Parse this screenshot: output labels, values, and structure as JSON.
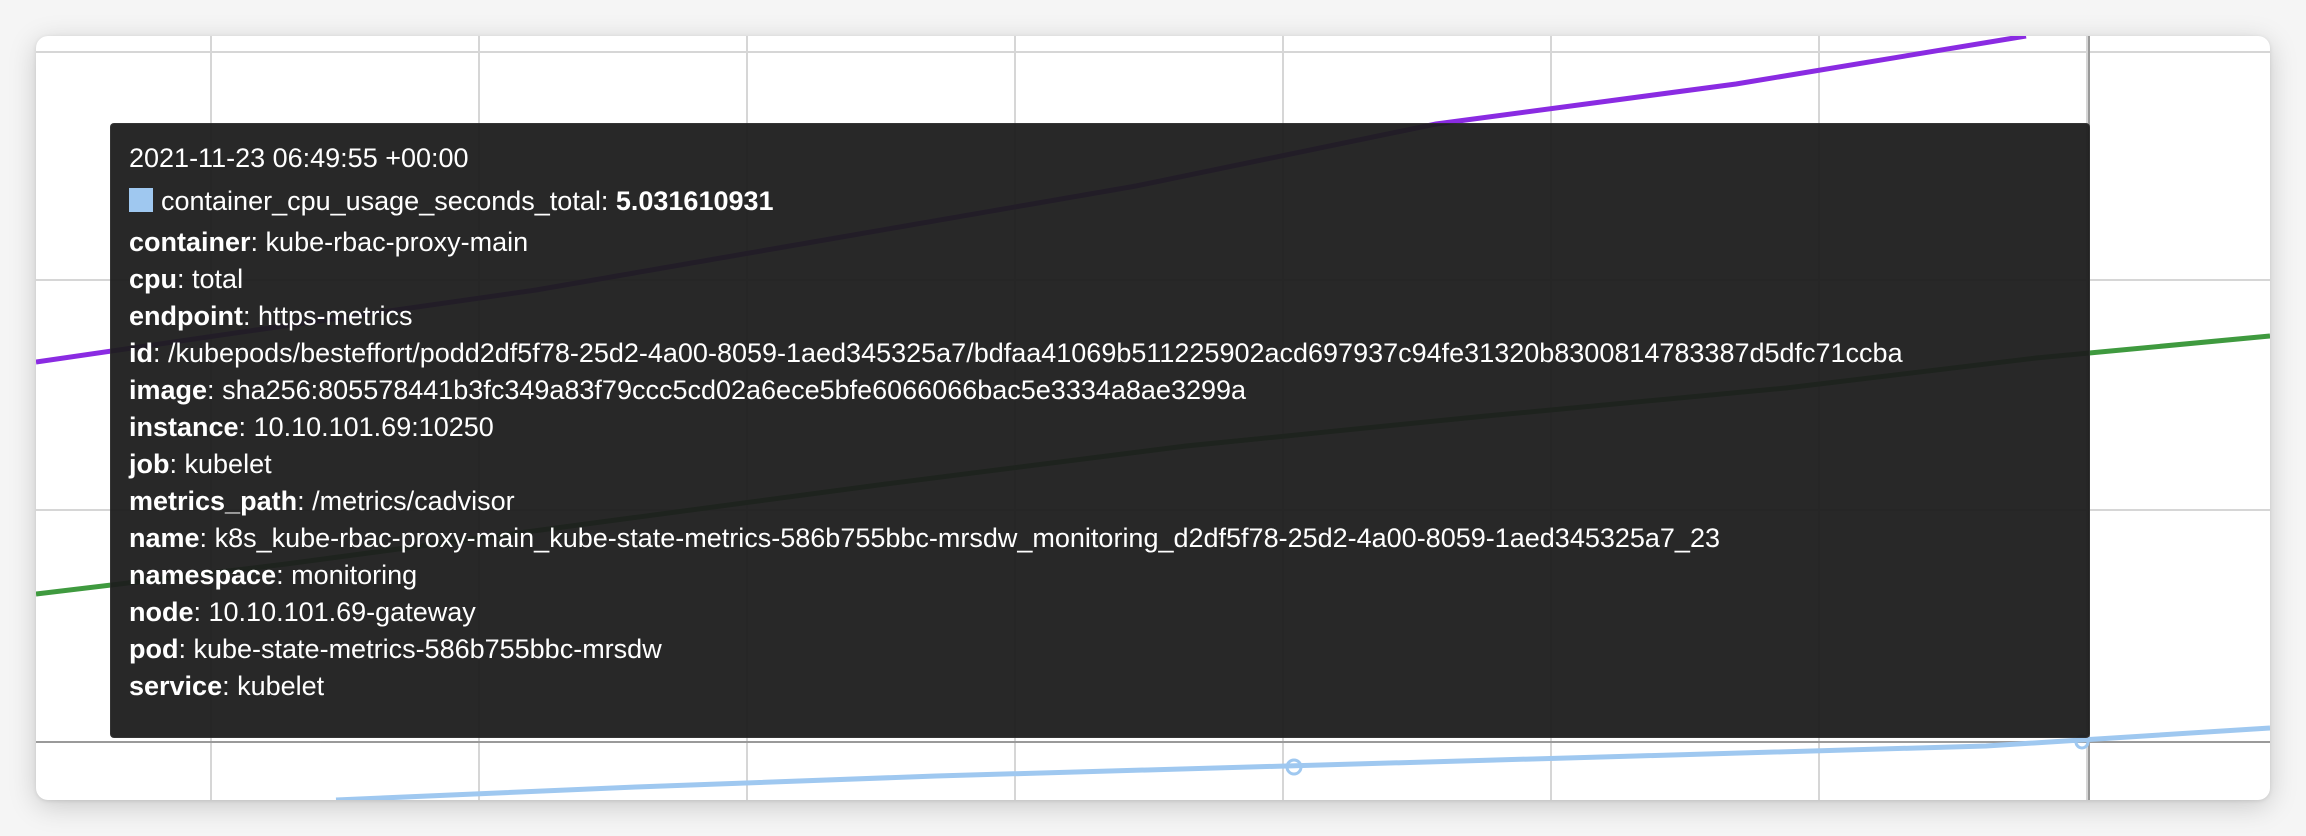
{
  "tooltip": {
    "timestamp": "2021-11-23 06:49:55 +00:00",
    "series_name": "container_cpu_usage_seconds_total",
    "value": "5.031610931",
    "swatch_color": "#9fc8f0",
    "labels": [
      {
        "key": "container",
        "value": "kube-rbac-proxy-main"
      },
      {
        "key": "cpu",
        "value": "total"
      },
      {
        "key": "endpoint",
        "value": "https-metrics"
      },
      {
        "key": "id",
        "value": "/kubepods/besteffort/podd2df5f78-25d2-4a00-8059-1aed345325a7/bdfaa41069b511225902acd697937c94fe31320b8300814783387d5dfc71ccba"
      },
      {
        "key": "image",
        "value": "sha256:805578441b3fc349a83f79ccc5cd02a6ece5bfe6066066bac5e3334a8ae3299a"
      },
      {
        "key": "instance",
        "value": "10.10.101.69:10250"
      },
      {
        "key": "job",
        "value": "kubelet"
      },
      {
        "key": "metrics_path",
        "value": "/metrics/cadvisor"
      },
      {
        "key": "name",
        "value": "k8s_kube-rbac-proxy-main_kube-state-metrics-586b755bbc-mrsdw_monitoring_d2df5f78-25d2-4a00-8059-1aed345325a7_23"
      },
      {
        "key": "namespace",
        "value": "monitoring"
      },
      {
        "key": "node",
        "value": "10.10.101.69-gateway"
      },
      {
        "key": "pod",
        "value": "kube-state-metrics-586b755bbc-mrsdw"
      },
      {
        "key": "service",
        "value": "kubelet"
      }
    ]
  },
  "series_colors": {
    "purple": "#8a2be2",
    "green": "#3f9a3f",
    "light_blue": "#9fc8f0"
  }
}
